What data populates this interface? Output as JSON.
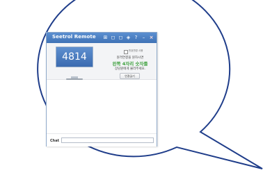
{
  "window": {
    "title": "Seetrol Remote",
    "icons": [
      "clipboard-icon",
      "monitor-icon",
      "chat-icon",
      "screen-icon",
      "help-icon",
      "minimize-icon",
      "close-icon"
    ],
    "icon_glyphs": [
      "⊞",
      "◻",
      "◻",
      "◈",
      "?",
      "–",
      "×"
    ]
  },
  "connection": {
    "pin": "4814",
    "checkbox_label": "번호변경 사용",
    "line1": "원격연결을 원하시면",
    "line2": "왼쪽 4자리 숫자를",
    "line3": "상담원에게 불러주세요.",
    "button_label": "연결끊기"
  },
  "chat": {
    "label": "Chat",
    "value": ""
  },
  "colors": {
    "titlebar": "#4a7fc4",
    "highlight": "#3ea03e"
  }
}
